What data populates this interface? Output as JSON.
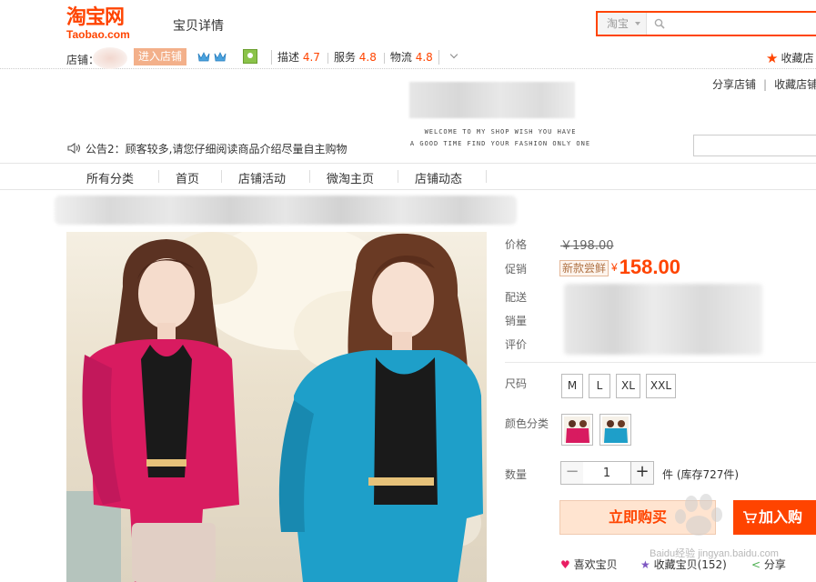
{
  "header": {
    "logo_cn": "淘宝网",
    "logo_en": "Taobao.com",
    "page_title": "宝贝详情",
    "search_scope": "淘宝",
    "search_placeholder": ""
  },
  "shop_bar": {
    "shop_label": "店铺：",
    "enter_shop": "进入店铺",
    "ratings": [
      {
        "label": "描述",
        "value": "4.7"
      },
      {
        "label": "服务",
        "value": "4.8"
      },
      {
        "label": "物流",
        "value": "4.8"
      }
    ],
    "favorite_shop": "收藏店"
  },
  "shop_header": {
    "share_shop": "分享店铺",
    "favorite_shop": "收藏店铺",
    "welcome_line1": "WELCOME TO MY SHOP WISH YOU HAVE",
    "welcome_line2": "A GOOD TIME FIND YOUR FASHION ONLY ONE",
    "notice": "公告2：顾客较多,请您仔细阅读商品介绍尽量自主购物"
  },
  "nav": [
    "所有分类",
    "首页",
    "店铺活动",
    "微淘主页",
    "店铺动态"
  ],
  "product": {
    "labels": {
      "price": "价格",
      "promo": "促销",
      "delivery": "配送",
      "sales": "销量",
      "reviews": "评价",
      "size": "尺码",
      "color": "颜色分类",
      "quantity": "数量"
    },
    "original_price": "￥198.00",
    "promo_tag": "新款尝鲜",
    "currency": "¥",
    "promo_price": "158.00",
    "sizes": [
      "M",
      "L",
      "XL",
      "XXL"
    ],
    "colors": [
      "rose-red",
      "lake-blue"
    ],
    "quantity": "1",
    "minus": "−",
    "plus": "+",
    "stock": "件 (库存727件)",
    "buy_now": "立即购买",
    "add_to_cart": "加入购",
    "like": "喜欢宝贝",
    "collect": "收藏宝贝(152)",
    "share": "分享"
  },
  "watermark": {
    "text": "Baidu经验",
    "url": "jingyan.baidu.com"
  },
  "colors": {
    "brand": "#ff4400",
    "rose": "#d81b60",
    "teal": "#1e9fc9"
  }
}
